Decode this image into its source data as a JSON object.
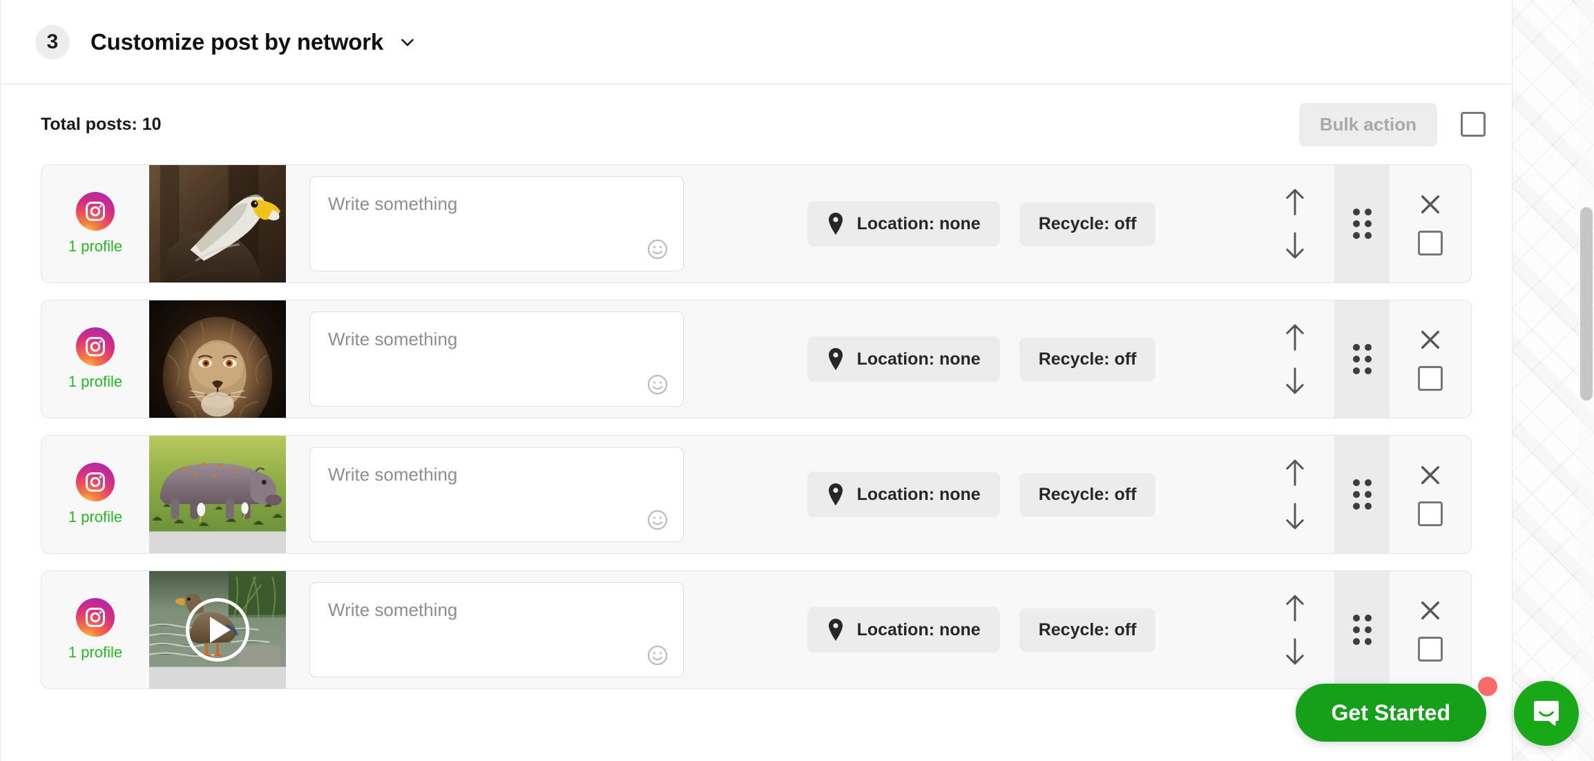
{
  "header": {
    "step_number": "3",
    "title": "Customize post by network",
    "chevron_icon": "chevron-down-icon"
  },
  "toolbar": {
    "total_posts_label": "Total posts:",
    "total_posts_value": "10",
    "total_posts_text": "Total posts: 10",
    "bulk_action_label": "Bulk action",
    "bulk_action_disabled": true,
    "select_all_checked": false
  },
  "common": {
    "write_placeholder": "Write something",
    "emoji_icon": "emoji-smiley-icon",
    "location_icon": "map-pin-icon",
    "move_up_icon": "arrow-up-icon",
    "move_down_icon": "arrow-down-icon",
    "drag_icon": "drag-handle-dots-icon",
    "remove_icon": "close-x-icon",
    "select_icon": "checkbox-icon",
    "network_icon": "instagram-icon",
    "play_icon": "play-button-icon"
  },
  "colors": {
    "accent_green": "#22bb22",
    "cta_green": "#15a01a",
    "notification_red": "#f96a6a",
    "row_bg": "#f8f8f8",
    "chip_bg": "#ececec"
  },
  "posts": [
    {
      "network": "Instagram",
      "profiles_label": "1 profile",
      "caption_value": "",
      "caption_placeholder": "Write something",
      "location_label": "Location: none",
      "recycle_label": "Recycle: off",
      "media_type": "image",
      "media_alt": "bald eagle head in profile",
      "selected": false
    },
    {
      "network": "Instagram",
      "profiles_label": "1 profile",
      "caption_value": "",
      "caption_placeholder": "Write something",
      "location_label": "Location: none",
      "recycle_label": "Recycle: off",
      "media_type": "image",
      "media_alt": "lion portrait on dark background",
      "selected": false
    },
    {
      "network": "Instagram",
      "profiles_label": "1 profile",
      "caption_value": "",
      "caption_placeholder": "Write something",
      "location_label": "Location: none",
      "recycle_label": "Recycle: off",
      "media_type": "image",
      "media_alt": "hippopotamus grazing on green grass",
      "selected": false
    },
    {
      "network": "Instagram",
      "profiles_label": "1 profile",
      "caption_value": "",
      "caption_placeholder": "Write something",
      "location_label": "Location: none",
      "recycle_label": "Recycle: off",
      "media_type": "video",
      "media_alt": "duck standing in water",
      "selected": false
    }
  ],
  "widgets": {
    "get_started_label": "Get Started",
    "has_notification": true,
    "chat_icon": "intercom-chat-icon"
  }
}
